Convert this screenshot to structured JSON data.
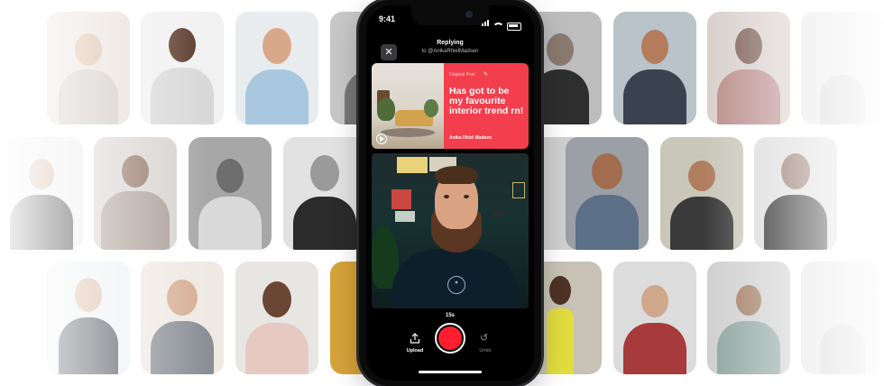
{
  "status_bar": {
    "time": "9:41"
  },
  "reply_header": {
    "title": "Replying",
    "subtitle": "to @AnikaRhielMadsen"
  },
  "original_post": {
    "label": "Original Post",
    "text": "Has got to be my favourite interior trend rn!",
    "author": "Anika Rhiel Madsen"
  },
  "recorder": {
    "timer": "15s",
    "upload_label": "Upload",
    "undo_label": "Undo"
  },
  "colors": {
    "accent_red": "#ff1f2d",
    "card_red": "#f23e4d",
    "phone_black": "#0b0b0c"
  },
  "icons": {
    "close": "close-icon",
    "upload": "upload-icon",
    "undo": "undo-icon",
    "play": "play-icon",
    "original_post": "edit-icon"
  }
}
